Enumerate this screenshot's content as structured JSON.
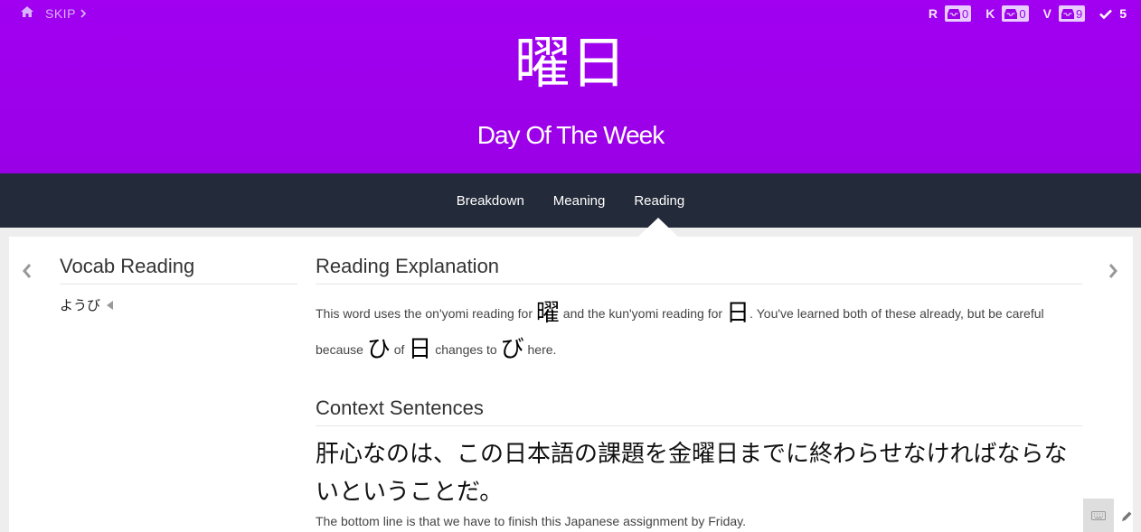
{
  "header": {
    "skip_label": "SKIP",
    "kanji": "曜日",
    "meaning": "Day Of The Week",
    "stats": [
      {
        "label": "R",
        "count": "0"
      },
      {
        "label": "K",
        "count": "0"
      },
      {
        "label": "V",
        "count": "9"
      }
    ],
    "done_count": "5",
    "colors": {
      "header_bg": "#a100f1",
      "tabbar_bg": "#232a39"
    }
  },
  "tabs": [
    {
      "label": "Breakdown"
    },
    {
      "label": "Meaning"
    },
    {
      "label": "Reading"
    }
  ],
  "active_tab": "Reading",
  "vocab": {
    "title": "Vocab Reading",
    "reading": "ようび"
  },
  "explanation": {
    "title": "Reading Explanation",
    "part1": "This word uses the on'yomi reading for ",
    "kanji1": "曜",
    "part2": " and the kun'yomi reading for ",
    "kanji2": "日",
    "part3": ". You've learned both of these already, but be careful because ",
    "kana1": "ひ",
    "part4": " of ",
    "kanji3": "日",
    "part5": " changes to ",
    "kana2": "び",
    "part6": " here."
  },
  "context": {
    "title": "Context Sentences",
    "ja": "肝心なのは、この日本語の課題を金曜日までに終わらせなければならないということだ。",
    "en": "The bottom line is that we have to finish this Japanese assignment by Friday."
  }
}
